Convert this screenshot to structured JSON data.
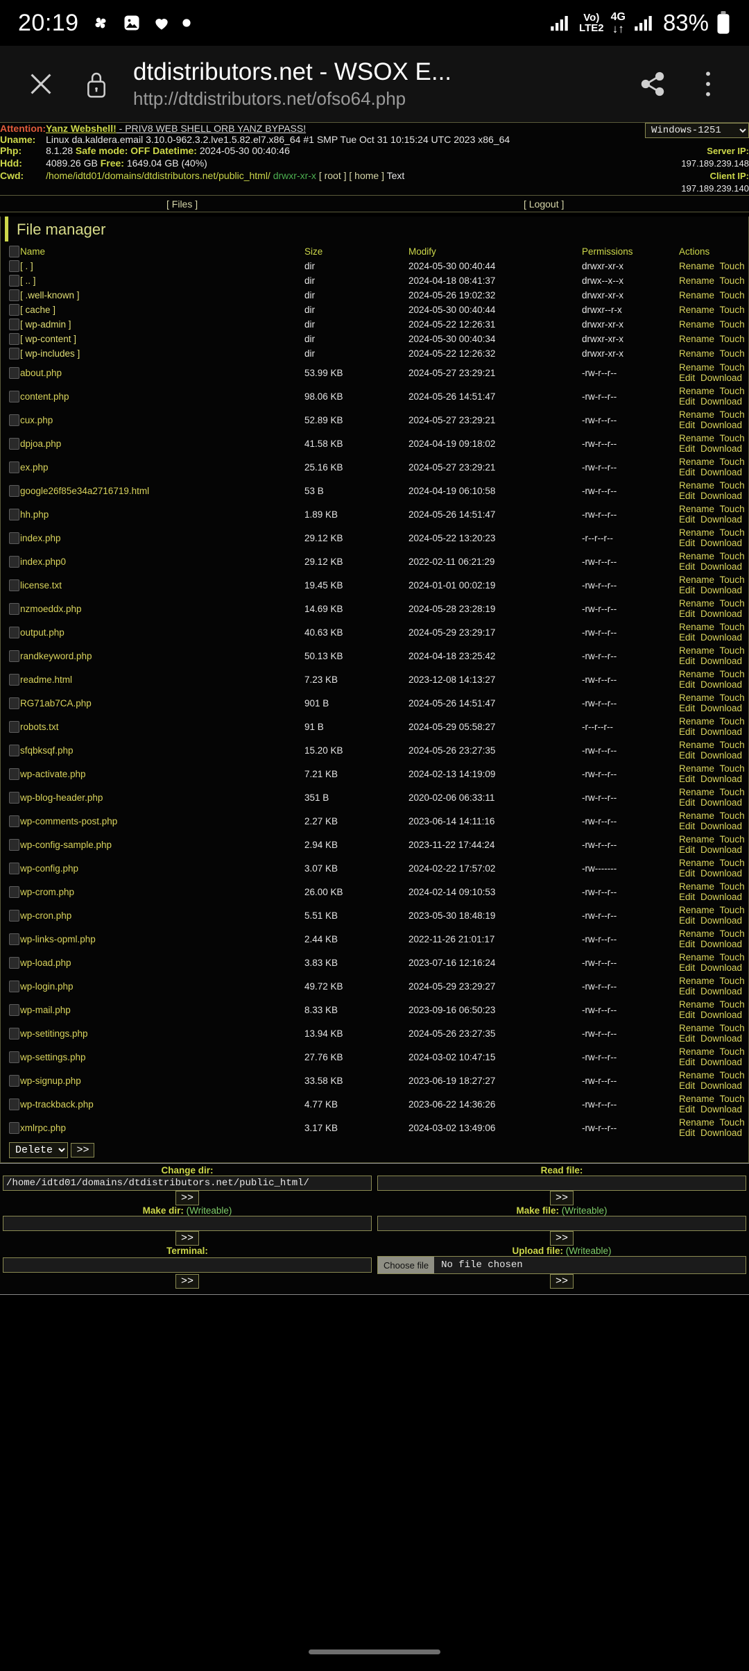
{
  "statusbar": {
    "clock": "20:19",
    "icons": [
      "fan-icon",
      "photo-icon",
      "heart-icon",
      "dot-icon"
    ],
    "network": {
      "volte": "Vo)",
      "lte": "LTE2",
      "gen": "4G"
    },
    "battery_percent": "83%"
  },
  "browser": {
    "close_icon": "close-icon",
    "lock_icon": "lock-icon",
    "title": "dtdistributors.net - WSOX E...",
    "url": "http://dtdistributors.net/ofso64.php",
    "share_icon": "share-icon",
    "menu_icon": "overflow-menu-icon"
  },
  "info": {
    "attention_label": "Attention:",
    "attention_link": "Yanz Webshell!",
    "attention_rest": " - PRIV8 WEB SHELL ORB YANZ BYPASS!",
    "uname_label": "Uname:",
    "uname_value": "Linux da.kaldera.email 3.10.0-962.3.2.lve1.5.82.el7.x86_64 #1 SMP Tue Oct 31 10:15:24 UTC 2023 x86_64",
    "php_label": "Php:",
    "php_version": "8.1.28",
    "safe_mode_label": "Safe mode:",
    "safe_mode_value": "OFF",
    "datetime_label": "Datetime:",
    "datetime_value": "2024-05-30 00:40:46",
    "hdd_label": "Hdd:",
    "hdd_total": "4089.26 GB",
    "hdd_free_label": "Free:",
    "hdd_free_value": "1649.04 GB (40%)",
    "cwd_label": "Cwd:",
    "cwd_value": "/home/idtd01/domains/dtdistributors.net/public_html/",
    "cwd_perm": "drwxr-xr-x",
    "cwd_root": "[ root ]",
    "cwd_home": "[ home ]",
    "cwd_text": "Text",
    "encoding_selected": "Windows-1251",
    "encoding_options": [
      "Windows-1251"
    ],
    "server_ip_label": "Server IP:",
    "server_ip": "197.189.239.148",
    "client_ip_label": "Client IP:",
    "client_ip": "197.189.239.140"
  },
  "nav": {
    "files": "[ Files ]",
    "logout": "[ Logout ]"
  },
  "filemanager": {
    "title": "File manager",
    "columns": [
      "Name",
      "Size",
      "Modify",
      "Permissions",
      "Actions"
    ],
    "bulk_action_selected": "Delete",
    "bulk_action_options": [
      "Delete"
    ],
    "go_label": ">>",
    "rows": [
      {
        "name": "[ . ]",
        "dir": true,
        "size": "dir",
        "modify": "2024-05-30 00:40:44",
        "perm": "drwxr-xr-x",
        "perm_green": false,
        "actions": [
          "Rename",
          "Touch"
        ]
      },
      {
        "name": "[ .. ]",
        "dir": true,
        "size": "dir",
        "modify": "2024-04-18 08:41:37",
        "perm": "drwx--x--x",
        "perm_green": false,
        "actions": [
          "Rename",
          "Touch"
        ]
      },
      {
        "name": "[ .well-known ]",
        "dir": true,
        "size": "dir",
        "modify": "2024-05-26 19:02:32",
        "perm": "drwxr-xr-x",
        "perm_green": false,
        "actions": [
          "Rename",
          "Touch"
        ]
      },
      {
        "name": "[ cache ]",
        "dir": true,
        "size": "dir",
        "modify": "2024-05-30 00:40:44",
        "perm": "drwxr--r-x",
        "perm_green": false,
        "actions": [
          "Rename",
          "Touch"
        ]
      },
      {
        "name": "[ wp-admin ]",
        "dir": true,
        "size": "dir",
        "modify": "2024-05-22 12:26:31",
        "perm": "drwxr-xr-x",
        "perm_green": false,
        "actions": [
          "Rename",
          "Touch"
        ]
      },
      {
        "name": "[ wp-content ]",
        "dir": true,
        "size": "dir",
        "modify": "2024-05-30 00:40:34",
        "perm": "drwxr-xr-x",
        "perm_green": false,
        "actions": [
          "Rename",
          "Touch"
        ]
      },
      {
        "name": "[ wp-includes ]",
        "dir": true,
        "size": "dir",
        "modify": "2024-05-22 12:26:32",
        "perm": "drwxr-xr-x",
        "perm_green": false,
        "actions": [
          "Rename",
          "Touch"
        ]
      },
      {
        "name": "about.php",
        "dir": false,
        "size": "53.99 KB",
        "modify": "2024-05-27 23:29:21",
        "perm": "-rw-r--r--",
        "perm_green": false,
        "actions": [
          "Rename",
          "Touch",
          "Edit",
          "Download"
        ]
      },
      {
        "name": "content.php",
        "dir": false,
        "size": "98.06 KB",
        "modify": "2024-05-26 14:51:47",
        "perm": "-rw-r--r--",
        "perm_green": false,
        "actions": [
          "Rename",
          "Touch",
          "Edit",
          "Download"
        ]
      },
      {
        "name": "cux.php",
        "dir": false,
        "size": "52.89 KB",
        "modify": "2024-05-27 23:29:21",
        "perm": "-rw-r--r--",
        "perm_green": false,
        "actions": [
          "Rename",
          "Touch",
          "Edit",
          "Download"
        ]
      },
      {
        "name": "dpjoa.php",
        "dir": false,
        "size": "41.58 KB",
        "modify": "2024-04-19 09:18:02",
        "perm": "-rw-r--r--",
        "perm_green": false,
        "actions": [
          "Rename",
          "Touch",
          "Edit",
          "Download"
        ]
      },
      {
        "name": "ex.php",
        "dir": false,
        "size": "25.16 KB",
        "modify": "2024-05-27 23:29:21",
        "perm": "-rw-r--r--",
        "perm_green": false,
        "actions": [
          "Rename",
          "Touch",
          "Edit",
          "Download"
        ]
      },
      {
        "name": "google26f85e34a2716719.html",
        "dir": false,
        "size": "53 B",
        "modify": "2024-04-19 06:10:58",
        "perm": "-rw-r--r--",
        "perm_green": false,
        "actions": [
          "Rename",
          "Touch",
          "Edit",
          "Download"
        ]
      },
      {
        "name": "hh.php",
        "dir": false,
        "size": "1.89 KB",
        "modify": "2024-05-26 14:51:47",
        "perm": "-rw-r--r--",
        "perm_green": false,
        "actions": [
          "Rename",
          "Touch",
          "Edit",
          "Download"
        ]
      },
      {
        "name": "index.php",
        "dir": false,
        "size": "29.12 KB",
        "modify": "2024-05-22 13:20:23",
        "perm": "-r--r--r--",
        "perm_green": false,
        "actions": [
          "Rename",
          "Touch",
          "Edit",
          "Download"
        ]
      },
      {
        "name": "index.php0",
        "dir": false,
        "size": "29.12 KB",
        "modify": "2022-02-11 06:21:29",
        "perm": "-rw-r--r--",
        "perm_green": false,
        "actions": [
          "Rename",
          "Touch",
          "Edit",
          "Download"
        ]
      },
      {
        "name": "license.txt",
        "dir": false,
        "size": "19.45 KB",
        "modify": "2024-01-01 00:02:19",
        "perm": "-rw-r--r--",
        "perm_green": false,
        "actions": [
          "Rename",
          "Touch",
          "Edit",
          "Download"
        ]
      },
      {
        "name": "nzmoeddx.php",
        "dir": false,
        "size": "14.69 KB",
        "modify": "2024-05-28 23:28:19",
        "perm": "-rw-r--r--",
        "perm_green": false,
        "actions": [
          "Rename",
          "Touch",
          "Edit",
          "Download"
        ]
      },
      {
        "name": "output.php",
        "dir": false,
        "size": "40.63 KB",
        "modify": "2024-05-29 23:29:17",
        "perm": "-rw-r--r--",
        "perm_green": false,
        "actions": [
          "Rename",
          "Touch",
          "Edit",
          "Download"
        ]
      },
      {
        "name": "randkeyword.php",
        "dir": false,
        "size": "50.13 KB",
        "modify": "2024-04-18 23:25:42",
        "perm": "-rw-r--r--",
        "perm_green": false,
        "actions": [
          "Rename",
          "Touch",
          "Edit",
          "Download"
        ]
      },
      {
        "name": "readme.html",
        "dir": false,
        "size": "7.23 KB",
        "modify": "2023-12-08 14:13:27",
        "perm": "-rw-r--r--",
        "perm_green": false,
        "actions": [
          "Rename",
          "Touch",
          "Edit",
          "Download"
        ]
      },
      {
        "name": "RG71ab7CA.php",
        "dir": false,
        "size": "901 B",
        "modify": "2024-05-26 14:51:47",
        "perm": "-rw-r--r--",
        "perm_green": false,
        "actions": [
          "Rename",
          "Touch",
          "Edit",
          "Download"
        ]
      },
      {
        "name": "robots.txt",
        "dir": false,
        "size": "91 B",
        "modify": "2024-05-29 05:58:27",
        "perm": "-r--r--r--",
        "perm_green": false,
        "actions": [
          "Rename",
          "Touch",
          "Edit",
          "Download"
        ]
      },
      {
        "name": "sfqbksqf.php",
        "dir": false,
        "size": "15.20 KB",
        "modify": "2024-05-26 23:27:35",
        "perm": "-rw-r--r--",
        "perm_green": false,
        "actions": [
          "Rename",
          "Touch",
          "Edit",
          "Download"
        ]
      },
      {
        "name": "wp-activate.php",
        "dir": false,
        "size": "7.21 KB",
        "modify": "2024-02-13 14:19:09",
        "perm": "-rw-r--r--",
        "perm_green": false,
        "actions": [
          "Rename",
          "Touch",
          "Edit",
          "Download"
        ]
      },
      {
        "name": "wp-blog-header.php",
        "dir": false,
        "size": "351 B",
        "modify": "2020-02-06 06:33:11",
        "perm": "-rw-r--r--",
        "perm_green": false,
        "actions": [
          "Rename",
          "Touch",
          "Edit",
          "Download"
        ]
      },
      {
        "name": "wp-comments-post.php",
        "dir": false,
        "size": "2.27 KB",
        "modify": "2023-06-14 14:11:16",
        "perm": "-rw-r--r--",
        "perm_green": false,
        "actions": [
          "Rename",
          "Touch",
          "Edit",
          "Download"
        ]
      },
      {
        "name": "wp-config-sample.php",
        "dir": false,
        "size": "2.94 KB",
        "modify": "2023-11-22 17:44:24",
        "perm": "-rw-r--r--",
        "perm_green": false,
        "actions": [
          "Rename",
          "Touch",
          "Edit",
          "Download"
        ]
      },
      {
        "name": "wp-config.php",
        "dir": false,
        "size": "3.07 KB",
        "modify": "2024-02-22 17:57:02",
        "perm": "-rw-------",
        "perm_green": false,
        "actions": [
          "Rename",
          "Touch",
          "Edit",
          "Download"
        ]
      },
      {
        "name": "wp-crom.php",
        "dir": false,
        "size": "26.00 KB",
        "modify": "2024-02-14 09:10:53",
        "perm": "-rw-r--r--",
        "perm_green": false,
        "actions": [
          "Rename",
          "Touch",
          "Edit",
          "Download"
        ]
      },
      {
        "name": "wp-cron.php",
        "dir": false,
        "size": "5.51 KB",
        "modify": "2023-05-30 18:48:19",
        "perm": "-rw-r--r--",
        "perm_green": false,
        "actions": [
          "Rename",
          "Touch",
          "Edit",
          "Download"
        ]
      },
      {
        "name": "wp-links-opml.php",
        "dir": false,
        "size": "2.44 KB",
        "modify": "2022-11-26 21:01:17",
        "perm": "-rw-r--r--",
        "perm_green": false,
        "actions": [
          "Rename",
          "Touch",
          "Edit",
          "Download"
        ]
      },
      {
        "name": "wp-load.php",
        "dir": false,
        "size": "3.83 KB",
        "modify": "2023-07-16 12:16:24",
        "perm": "-rw-r--r--",
        "perm_green": false,
        "actions": [
          "Rename",
          "Touch",
          "Edit",
          "Download"
        ]
      },
      {
        "name": "wp-login.php",
        "dir": false,
        "size": "49.72 KB",
        "modify": "2024-05-29 23:29:27",
        "perm": "-rw-r--r--",
        "perm_green": false,
        "actions": [
          "Rename",
          "Touch",
          "Edit",
          "Download"
        ]
      },
      {
        "name": "wp-mail.php",
        "dir": false,
        "size": "8.33 KB",
        "modify": "2023-09-16 06:50:23",
        "perm": "-rw-r--r--",
        "perm_green": false,
        "actions": [
          "Rename",
          "Touch",
          "Edit",
          "Download"
        ]
      },
      {
        "name": "wp-setitings.php",
        "dir": false,
        "size": "13.94 KB",
        "modify": "2024-05-26 23:27:35",
        "perm": "-rw-r--r--",
        "perm_green": false,
        "actions": [
          "Rename",
          "Touch",
          "Edit",
          "Download"
        ]
      },
      {
        "name": "wp-settings.php",
        "dir": false,
        "size": "27.76 KB",
        "modify": "2024-03-02 10:47:15",
        "perm": "-rw-r--r--",
        "perm_green": false,
        "actions": [
          "Rename",
          "Touch",
          "Edit",
          "Download"
        ]
      },
      {
        "name": "wp-signup.php",
        "dir": false,
        "size": "33.58 KB",
        "modify": "2023-06-19 18:27:27",
        "perm": "-rw-r--r--",
        "perm_green": false,
        "actions": [
          "Rename",
          "Touch",
          "Edit",
          "Download"
        ]
      },
      {
        "name": "wp-trackback.php",
        "dir": false,
        "size": "4.77 KB",
        "modify": "2023-06-22 14:36:26",
        "perm": "-rw-r--r--",
        "perm_green": false,
        "actions": [
          "Rename",
          "Touch",
          "Edit",
          "Download"
        ]
      },
      {
        "name": "xmlrpc.php",
        "dir": false,
        "size": "3.17 KB",
        "modify": "2024-03-02 13:49:06",
        "perm": "-rw-r--r--",
        "perm_green": false,
        "actions": [
          "Rename",
          "Touch",
          "Edit",
          "Download"
        ]
      }
    ]
  },
  "forms": {
    "change_dir_label": "Change dir:",
    "change_dir_value": "/home/idtd01/domains/dtdistributors.net/public_html/",
    "read_file_label": "Read file:",
    "read_file_value": "",
    "make_dir_label": "Make dir:",
    "make_dir_writeable": "(Writeable)",
    "make_dir_value": "",
    "make_file_label": "Make file:",
    "make_file_writeable": "(Writeable)",
    "make_file_value": "",
    "terminal_label": "Terminal:",
    "terminal_value": "",
    "upload_label": "Upload file:",
    "upload_writeable": "(Writeable)",
    "choose_file_label": "Choose file",
    "no_file_chosen": "No file chosen",
    "submit_label": ">>"
  },
  "colors": {
    "accent_yellow": "#cdd84a",
    "link_yellow": "#d8d35c",
    "green": "#4caf50",
    "red": "#e05a3a",
    "bg": "#000000",
    "border": "#5a5a3a"
  }
}
